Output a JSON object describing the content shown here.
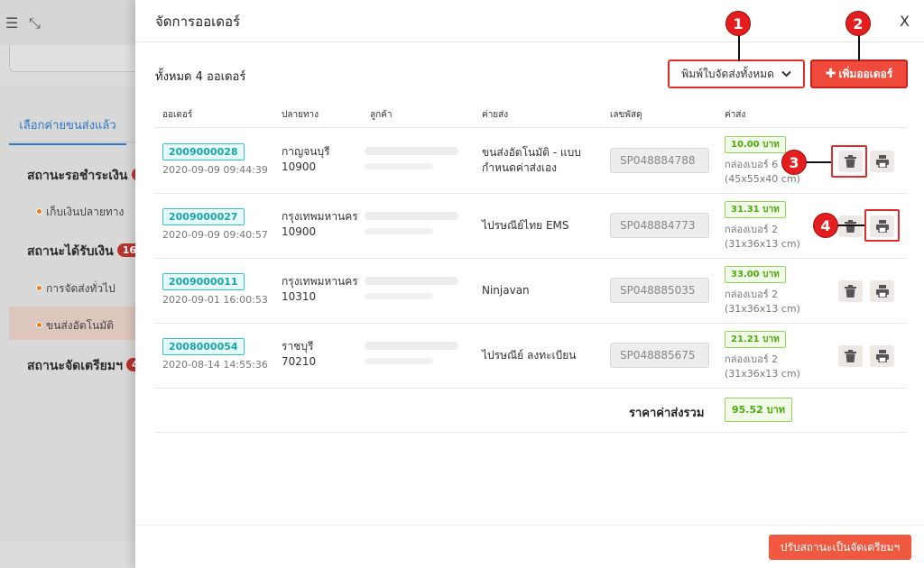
{
  "background": {
    "tab_label": "เลือกค่ายขนส่งแล้ว",
    "sections": [
      {
        "label": "สถานะรอชำระเงิน",
        "count": "1"
      },
      {
        "label": "สถานะได้รับเงิน",
        "count": "16"
      },
      {
        "label": "สถานะจัดเตรียมฯ",
        "count": "4"
      }
    ],
    "items": [
      "เก็บเงินปลายทาง",
      "การจัดส่งทั่วไป",
      "ขนส่งอัตโนมัติ"
    ]
  },
  "modal": {
    "title": "จัดการออเดอร์",
    "close_label": "X",
    "total_orders_label": "ทั้งหมด 4 ออเดอร์",
    "print_all_label": "พิมพ์ใบจัดส่งทั้งหมด",
    "add_order_label": "เพิ่มออเดอร์",
    "columns": [
      "ออเดอร์",
      "ปลายทาง",
      "ลูกค้า",
      "ค่ายส่ง",
      "เลขพัสดุ",
      "ค่าส่ง"
    ],
    "orders": [
      {
        "id": "2009000028",
        "date": "2020-09-09 09:44:39",
        "province": "กาญจนบุรี",
        "postcode": "10900",
        "carrier_line1": "ขนส่งอัตโนมัติ - แบบ",
        "carrier_line2": "กำหนดค่าส่งเอง",
        "tracking": "SP048884788",
        "cost": "10.00 บาท",
        "box_line1": "กล่องเบอร์ 6",
        "box_line2": "(45x55x40 cm)"
      },
      {
        "id": "2009000027",
        "date": "2020-09-09 09:40:57",
        "province": "กรุงเทพมหานคร",
        "postcode": "10900",
        "carrier_line1": "ไปรษณีย์ไทย EMS",
        "carrier_line2": "",
        "tracking": "SP048884773",
        "cost": "31.31 บาท",
        "box_line1": "กล่องเบอร์ 2",
        "box_line2": "(31x36x13 cm)"
      },
      {
        "id": "2009000011",
        "date": "2020-09-01 16:00:53",
        "province": "กรุงเทพมหานคร",
        "postcode": "10310",
        "carrier_line1": "Ninjavan",
        "carrier_line2": "",
        "tracking": "SP048885035",
        "cost": "33.00 บาท",
        "box_line1": "กล่องเบอร์ 2",
        "box_line2": "(31x36x13 cm)"
      },
      {
        "id": "2008000054",
        "date": "2020-08-14 14:55:36",
        "province": "ราชบุรี",
        "postcode": "70210",
        "carrier_line1": "ไปรษณีย์ ลงทะเบียน",
        "carrier_line2": "",
        "tracking": "SP048885675",
        "cost": "21.21 บาท",
        "box_line1": "กล่องเบอร์ 2",
        "box_line2": "(31x36x13 cm)"
      }
    ],
    "total_label": "ราคาค่าส่งรวม",
    "total_value": "95.52 บาท",
    "status_button_label": "ปรับสถานะเป็นจัดเตรียมฯ"
  },
  "callouts": [
    "1",
    "2",
    "3",
    "4"
  ],
  "colors": {
    "accent_red": "#f04b3a",
    "highlight_red": "#e22b2b",
    "order_teal": "#18a6a6",
    "cost_green": "#4bab0d",
    "link_blue": "#2d78c6"
  },
  "icons": {
    "sidebar_toggle": "menu-collapse-icon",
    "fullscreen": "fullscreen-exit-icon",
    "delete": "trash-icon",
    "print": "printer-icon",
    "dropdown": "chevron-down-icon",
    "add": "plus-icon"
  }
}
